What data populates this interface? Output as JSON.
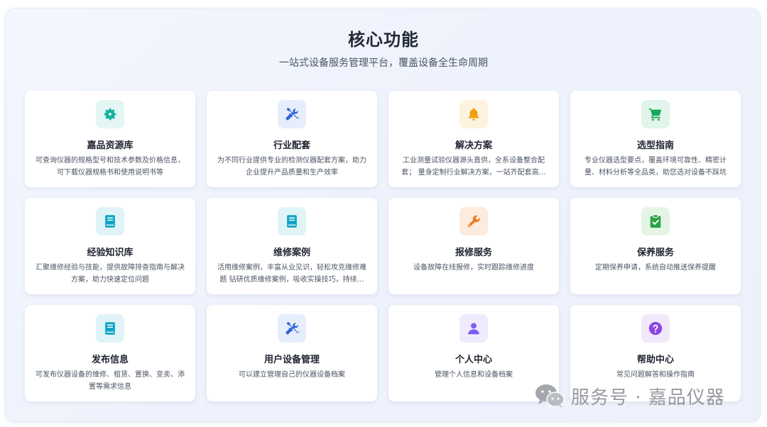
{
  "header": {
    "title": "核心功能",
    "subtitle": "一站式设备服务管理平台，覆盖设备全生命周期"
  },
  "cards": [
    {
      "title": "嘉品资源库",
      "desc": "可查询仪器的规格型号和技术参数及价格信息，可下载仪器规格书和使用说明书等",
      "icon": "gear-icon",
      "color": "#12b3a0",
      "bg": "#e3f6f3"
    },
    {
      "title": "行业配套",
      "desc": "为不同行业提供专业的检测仪器配套方案，助力企业提升产品质量和生产效率",
      "icon": "tools-icon",
      "color": "#2e64d8",
      "bg": "#e6eefb"
    },
    {
      "title": "解决方案",
      "desc": "工业测量试验仪器源头直供，全系设备整合配套； 量身定制行业解决方案，一站齐配套高效省心",
      "icon": "bell-icon",
      "color": "#f2a011",
      "bg": "#fdf3df"
    },
    {
      "title": "选型指南",
      "desc": "专业仪器选型要点，覆盖环境可靠性、精密计量、材料分析等全品类，助您选对设备不踩坑",
      "icon": "cart-icon",
      "color": "#17a85a",
      "bg": "#e1f5ea"
    },
    {
      "title": "经验知识库",
      "desc": "汇聚维修经验与技能，提供故障排查指南与解决方案，助力快速定位问题",
      "icon": "book-icon",
      "color": "#0ea5c6",
      "bg": "#e0f4f8"
    },
    {
      "title": "维修案例",
      "desc": "活用维修案例，丰富从业见识，轻松攻克维修难题 钻研优质维修案例，吸收实操技巧，持续精进",
      "icon": "book-icon",
      "color": "#0ea5c6",
      "bg": "#e0f4f8"
    },
    {
      "title": "报修服务",
      "desc": "设备故障在线报修，实时跟踪维修进度",
      "icon": "wrench-icon",
      "color": "#f07a18",
      "bg": "#fdebdd"
    },
    {
      "title": "保养服务",
      "desc": "定期保养申请，系统自动推送保养提醒",
      "icon": "clipboard-check-icon",
      "color": "#2ea043",
      "bg": "#e4f5e6"
    },
    {
      "title": "发布信息",
      "desc": "可发布仪器设备的维修、租赁、置换、变卖、添置等需求信息",
      "icon": "book-icon",
      "color": "#0ea5c6",
      "bg": "#e0f4f8"
    },
    {
      "title": "用户设备管理",
      "desc": "可以建立管理自己的仪器设备档案",
      "icon": "tools-icon",
      "color": "#2e64d8",
      "bg": "#e6eefb"
    },
    {
      "title": "个人中心",
      "desc": "管理个人信息和设备档案",
      "icon": "user-icon",
      "color": "#7c5cf0",
      "bg": "#efebfd"
    },
    {
      "title": "帮助中心",
      "desc": "常见问题解答和操作指南",
      "icon": "question-icon",
      "color": "#8b45e6",
      "bg": "#f1e8fc"
    }
  ],
  "watermark": {
    "text": "服务号 · 嘉品仪器",
    "icon": "wechat-icon"
  }
}
